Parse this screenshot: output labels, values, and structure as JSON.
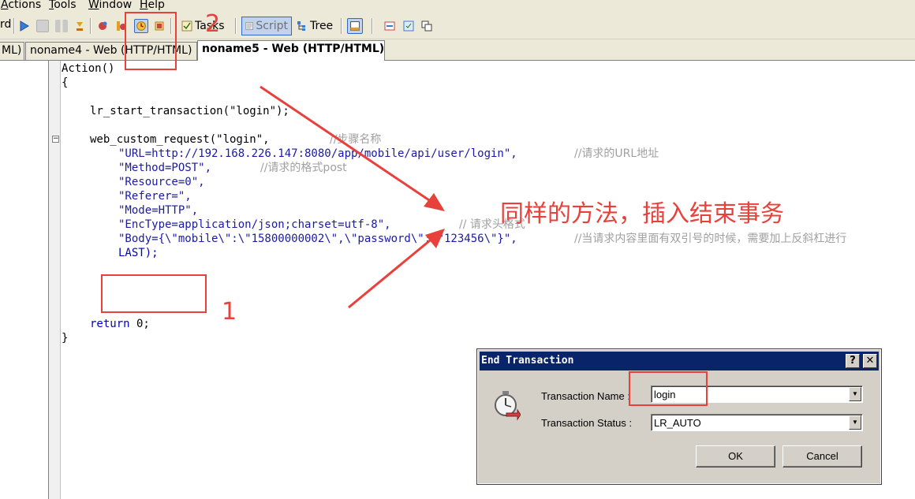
{
  "menu": {
    "items": [
      {
        "label": "Actions"
      },
      {
        "label": "Tools"
      },
      {
        "label": "Window"
      },
      {
        "label": "Help"
      }
    ]
  },
  "toolbar": {
    "record_label_fragment": "rd",
    "tasks_label": "Tasks",
    "script_label": "Script",
    "tree_label": "Tree"
  },
  "tabs": [
    {
      "label": "ML)"
    },
    {
      "label": "noname4 - Web (HTTP/HTML)"
    },
    {
      "label": "noname5 - Web (HTTP/HTML)",
      "active": true
    }
  ],
  "code": {
    "l1": "Action()",
    "l2": "{",
    "l3": "lr_start_transaction(\"login\");",
    "l4_code": "web_custom_request(\"login\",",
    "l4_comment": "//步骤名称",
    "l5_code": "\"URL=http://192.168.226.147:8080/app/mobile/api/user/login\",",
    "l5_comment": "//请求的URL地址",
    "l6_code": "\"Method=POST\",",
    "l6_comment": "//请求的格式post",
    "l7": "\"Resource=0\",",
    "l8": "\"Referer=\",",
    "l9": "\"Mode=HTTP\",",
    "l10_code": "\"EncType=application/json;charset=utf-8\",",
    "l10_comment": "// 请求头格式",
    "l11_code": "\"Body={\\\"mobile\\\":\\\"15800000002\\\",\\\"password\\\":\\\"123456\\\"}\",",
    "l11_comment": "//当请求内容里面有双引号的时候，需要加上反斜杠进行",
    "l12": "LAST);",
    "l13_kw": "return",
    "l13_rest": " 0;",
    "l14": "}"
  },
  "annotations": {
    "num1": "1",
    "num2": "2",
    "text": "同样的方法，插入结束事务"
  },
  "dialog": {
    "title": "End Transaction",
    "help_btn": "?",
    "close_btn": "✕",
    "name_label": "Transaction Name :",
    "name_value": "login",
    "status_label": "Transaction Status :",
    "status_value": "LR_AUTO",
    "ok_label": "OK",
    "cancel_label": "Cancel"
  },
  "colors": {
    "annotation_red": "#e8413b",
    "titlebar_blue": "#0a246a"
  }
}
